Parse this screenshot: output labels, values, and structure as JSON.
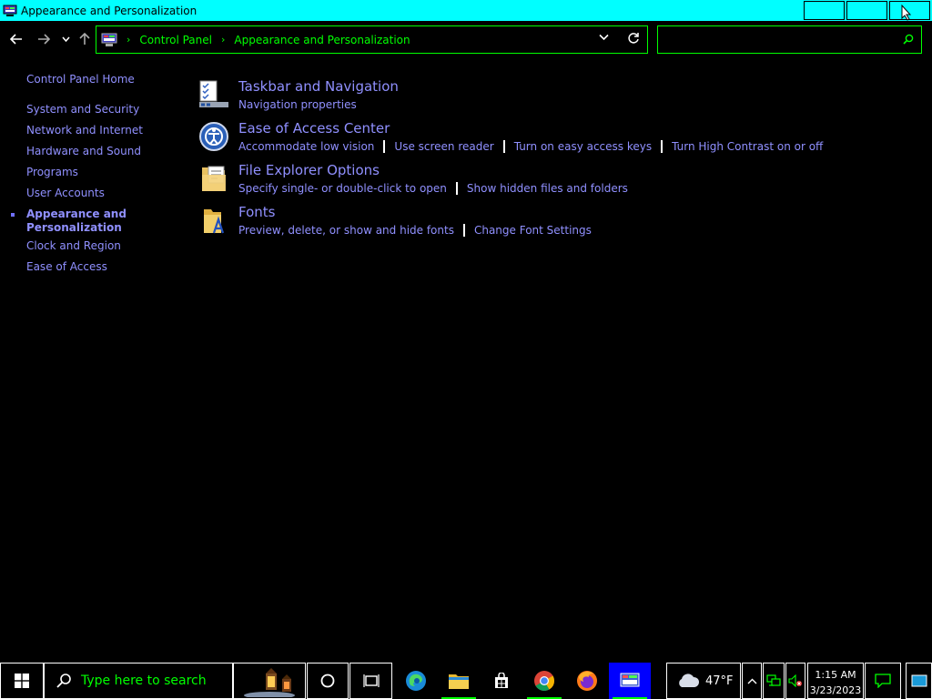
{
  "window": {
    "title": "Appearance and Personalization"
  },
  "address": {
    "crumbs": [
      "Control Panel",
      "Appearance and Personalization"
    ]
  },
  "search": {
    "placeholder": ""
  },
  "sidebar": {
    "items": [
      {
        "label": "Control Panel Home"
      },
      {
        "label": "System and Security"
      },
      {
        "label": "Network and Internet"
      },
      {
        "label": "Hardware and Sound"
      },
      {
        "label": "Programs"
      },
      {
        "label": "User Accounts"
      },
      {
        "label": "Appearance and Personalization",
        "active": true
      },
      {
        "label": "Clock and Region"
      },
      {
        "label": "Ease of Access"
      }
    ]
  },
  "categories": [
    {
      "title": "Taskbar and Navigation",
      "icon": "taskbar-icon",
      "links": [
        "Navigation properties"
      ]
    },
    {
      "title": "Ease of Access Center",
      "icon": "ease-of-access-icon",
      "links": [
        "Accommodate low vision",
        "Use screen reader",
        "Turn on easy access keys",
        "Turn High Contrast on or off"
      ]
    },
    {
      "title": "File Explorer Options",
      "icon": "folder-options-icon",
      "links": [
        "Specify single- or double-click to open",
        "Show hidden files and folders"
      ]
    },
    {
      "title": "Fonts",
      "icon": "fonts-icon",
      "links": [
        "Preview, delete, or show and hide fonts",
        "Change Font Settings"
      ]
    }
  ],
  "taskbar": {
    "search_placeholder": "Type here to search",
    "weather_temp": "47°F",
    "time": "1:15 AM",
    "date": "3/23/2023"
  },
  "colors": {
    "titlebar": "#00ffff",
    "accent": "#00ff00",
    "link": "#9090ff",
    "background": "#000000"
  }
}
